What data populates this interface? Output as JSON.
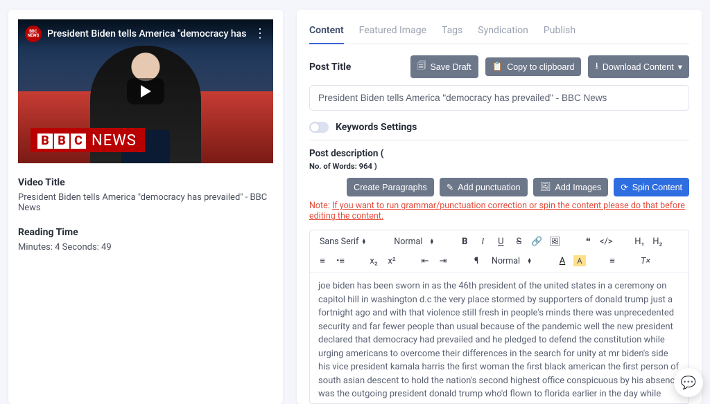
{
  "video": {
    "overlay_title": "President Biden tells America \"democracy has ...",
    "bbc_news_word": "NEWS",
    "label_title": "Video Title",
    "title": "President Biden tells America \"democracy has prevailed\" - BBC News",
    "label_reading": "Reading Time",
    "reading": "Minutes: 4 Seconds: 49"
  },
  "tabs": {
    "content": "Content",
    "featured": "Featured Image",
    "tags": "Tags",
    "syndication": "Syndication",
    "publish": "Publish"
  },
  "buttons": {
    "save_draft": "Save Draft",
    "copy": "Copy to clipboard",
    "download": "Download Content",
    "create_paragraphs": "Create Paragraphs",
    "add_punctuation": "Add punctuation",
    "add_images": "Add Images",
    "spin": "Spin Content"
  },
  "labels": {
    "post_title": "Post Title",
    "keywords": "Keywords Settings",
    "post_description_prefix": "Post description",
    "word_count_line": "No. of Words: 964 )",
    "note_label": "Note:",
    "note_text": "If you want to run grammar/punctuation correction or spin the content please do that before editing the content."
  },
  "fields": {
    "post_title_value": "President Biden tells America \"democracy has prevailed\" - BBC News"
  },
  "editor_toolbar": {
    "font": "Sans Serif",
    "size": "Normal",
    "lineheight": "Normal",
    "h1": "H₁",
    "h2": "H₂"
  },
  "editor_body": "joe biden has been sworn in as the 46th president of the united states in a ceremony on capitol hill in washington d.c the very place stormed by supporters of donald trump just a fortnight ago and with that violence still fresh in people's minds there was unprecedented security and far fewer people than usual because of the pandemic well the new president declared that democracy had prevailed and he pledged to defend the constitution while urging americans to overcome their differences in the search for unity at mr biden's side his vice president kamala harris the first woman the first black american the first person of south asian descent to hold the nation's second highest office conspicuous by his absence was the outgoing president donald trump who'd flown to florida earlier in the day while promising his fans to be back in some form we'll be looking at the new president's agenda and what it means for u.s relations with the rest of the world but we start with the events of the day with our north america editor john soppel hugh donald trump left the white house for the last time this morning after that an army of cleaners went in to spruce the place up and then about an hour ago joe biden arrived with his"
}
